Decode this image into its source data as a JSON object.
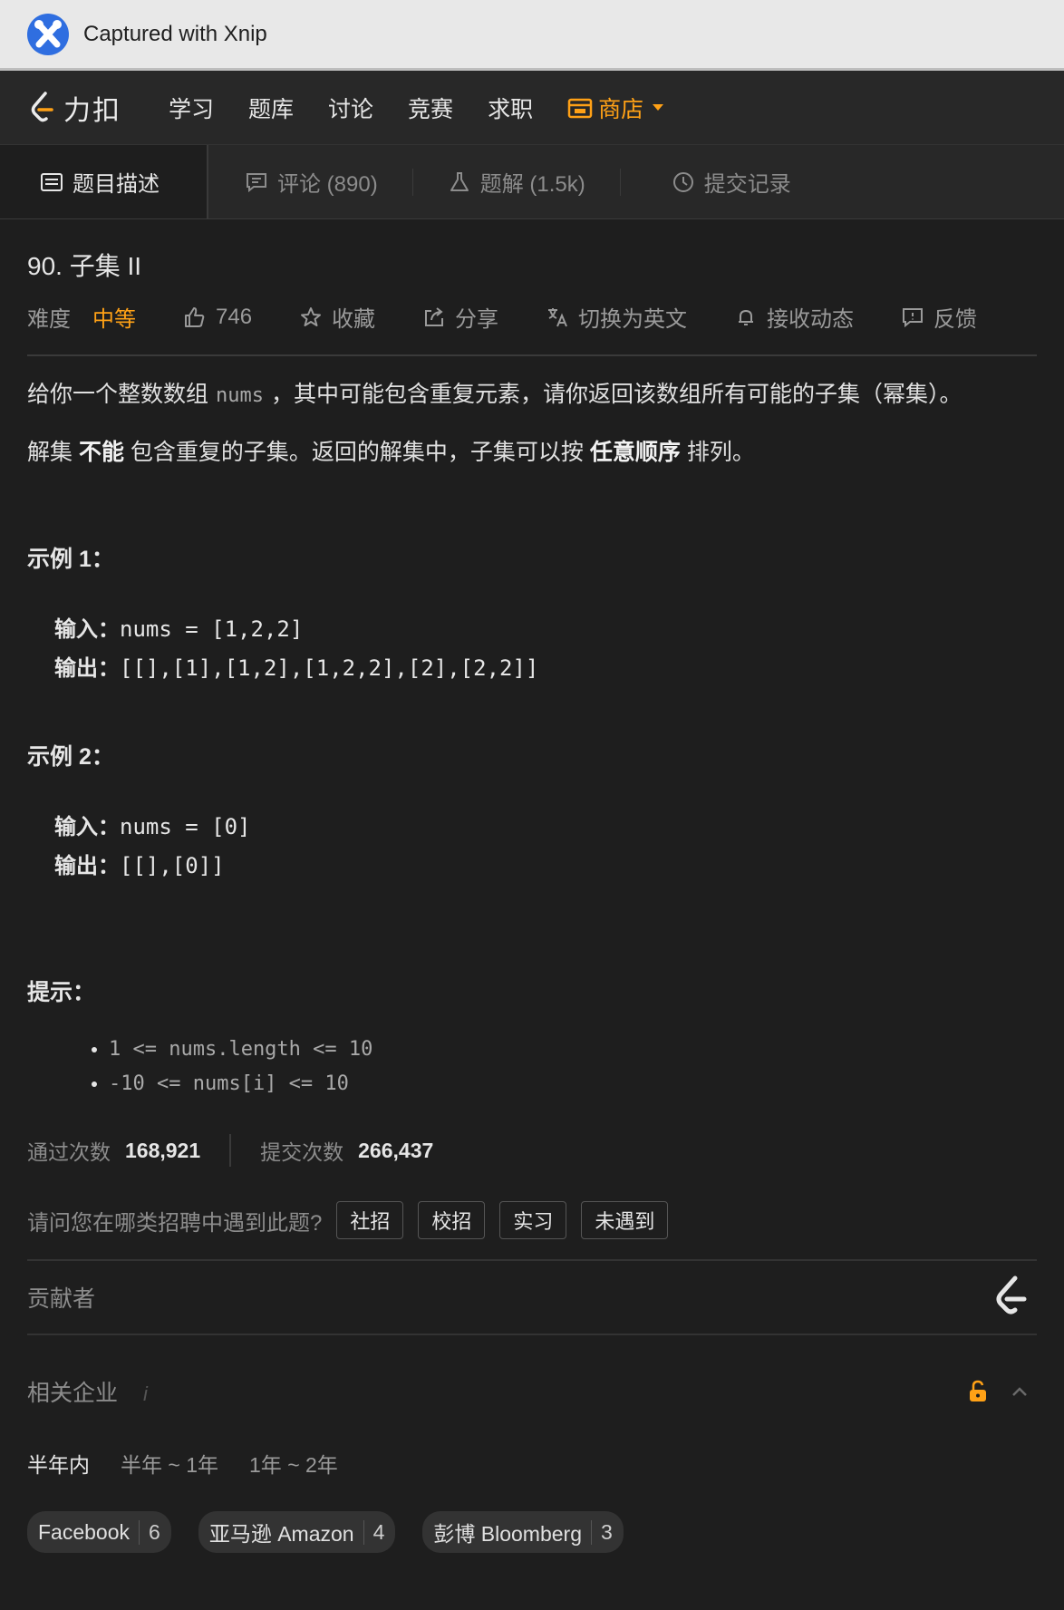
{
  "titlebar": {
    "text": "Captured with Xnip"
  },
  "nav": {
    "brand": "力扣",
    "items": [
      "学习",
      "题库",
      "讨论",
      "竞赛",
      "求职"
    ],
    "store": "商店",
    "store_color": "#ffa116"
  },
  "tabs": {
    "description": "题目描述",
    "comments": "评论 (890)",
    "solutions": "题解 (1.5k)",
    "submissions": "提交记录"
  },
  "problem": {
    "title": "90. 子集 II",
    "difficulty_label": "难度",
    "difficulty": "中等",
    "likes": "746",
    "favorite": "收藏",
    "share": "分享",
    "switch_lang": "切换为英文",
    "subscribe": "接收动态",
    "feedback": "反馈"
  },
  "description": {
    "p1_before": "给你一个整数数组",
    "p1_code": "nums",
    "p1_after": "，其中可能包含重复元素，请你返回该数组所有可能的子集（幂集）。",
    "p2_a": "解集 ",
    "p2_b": "不能",
    "p2_c": " 包含重复的子集。返回的解集中，子集可以按 ",
    "p2_d": "任意顺序",
    "p2_e": " 排列。"
  },
  "examples": [
    {
      "title": "示例 1：",
      "input_label": "输入：",
      "input": "nums = [1,2,2]",
      "output_label": "输出：",
      "output": "[[],[1],[1,2],[1,2,2],[2],[2,2]]"
    },
    {
      "title": "示例 2：",
      "input_label": "输入：",
      "input": "nums = [0]",
      "output_label": "输出：",
      "output": "[[],[0]]"
    }
  ],
  "hints": {
    "title": "提示：",
    "items": [
      "1 <= nums.length <= 10",
      "-10 <= nums[i] <= 10"
    ]
  },
  "stats": {
    "accepted_label": "通过次数",
    "accepted": "168,921",
    "submitted_label": "提交次数",
    "submitted": "266,437"
  },
  "recruit": {
    "question": "请问您在哪类招聘中遇到此题?",
    "options": [
      "社招",
      "校招",
      "实习",
      "未遇到"
    ]
  },
  "contributors": {
    "label": "贡献者"
  },
  "companies": {
    "label": "相关企业",
    "info": "i",
    "periods": [
      "半年内",
      "半年 ~ 1年",
      "1年 ~ 2年"
    ],
    "list": [
      {
        "name": "Facebook",
        "count": "6"
      },
      {
        "name": "亚马逊 Amazon",
        "count": "4"
      },
      {
        "name": "彭博 Bloomberg",
        "count": "3"
      }
    ]
  }
}
